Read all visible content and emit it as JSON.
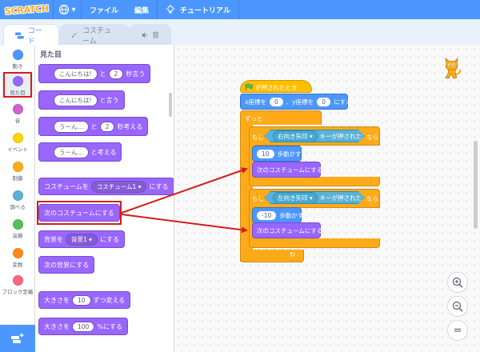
{
  "menubar": {
    "logo": "SCRATCH",
    "file": "ファイル",
    "edit": "編集",
    "tutorial": "チュートリアル"
  },
  "tabs": {
    "code": "コード",
    "costume": "コスチューム",
    "sound": "音"
  },
  "categories": [
    {
      "label": "動き",
      "color": "#4c97ff"
    },
    {
      "label": "見た目",
      "color": "#9966ff"
    },
    {
      "label": "音",
      "color": "#cf63cf"
    },
    {
      "label": "イベント",
      "color": "#ffd500"
    },
    {
      "label": "制御",
      "color": "#ffab19"
    },
    {
      "label": "調べる",
      "color": "#5cb1d6"
    },
    {
      "label": "演算",
      "color": "#59c059"
    },
    {
      "label": "変数",
      "color": "#ff8c1a"
    },
    {
      "label": "ブロック定義",
      "color": "#ff6680"
    }
  ],
  "palette": {
    "title": "見た目",
    "say_for": {
      "a": "こんにちは!",
      "b": "と",
      "c": "2",
      "d": "秒言う"
    },
    "say": {
      "a": "こんにちは!",
      "b": "と言う"
    },
    "think_for": {
      "a": "うーん...",
      "b": "と",
      "c": "2",
      "d": "秒考える"
    },
    "think": {
      "a": "うーん...",
      "b": "と考える"
    },
    "switch_costume": {
      "a": "コスチュームを",
      "b": "コスチューム1",
      "c": "にする"
    },
    "next_costume": "次のコスチュームにする",
    "switch_backdrop": {
      "a": "背景を",
      "b": "背景1",
      "c": "にする"
    },
    "next_backdrop": "次の背景にする",
    "change_size": {
      "a": "大きさを",
      "b": "10",
      "c": "ずつ変える"
    },
    "set_size": {
      "a": "大きさを",
      "b": "100",
      "c": "%にする"
    }
  },
  "script": {
    "hat": "が押されたとき",
    "goto": {
      "a": "x座標を",
      "b": "0",
      "c": "、y座標を",
      "d": "0",
      "e": "にする"
    },
    "forever": "ずっと",
    "if1": {
      "a": "もし",
      "key": "右向き矢印",
      "b": "キーが押された",
      "c": "なら"
    },
    "move1": {
      "val": "10",
      "label": "歩動かす"
    },
    "next1": "次のコスチュームにする",
    "if2": {
      "a": "もし",
      "key": "左向き矢印",
      "b": "キーが押された",
      "c": "なら"
    },
    "move2": {
      "val": "-10",
      "label": "歩動かす"
    },
    "next2": "次のコスチュームにする"
  },
  "colors": {
    "motion": "#4c97ff",
    "looks": "#9966ff",
    "control": "#ffab19",
    "events": "#ffbf00",
    "sensing": "#5cb1d6",
    "highlight": "#d41c1c"
  },
  "zoom": {
    "in": "+",
    "out": "−",
    "reset": "="
  }
}
